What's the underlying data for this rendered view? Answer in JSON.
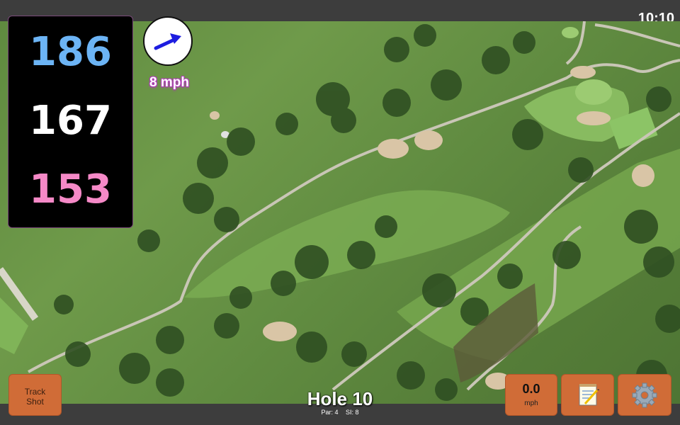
{
  "status": {
    "time": "10:10"
  },
  "distances": {
    "back": "186",
    "middle": "167",
    "front": "153"
  },
  "wind": {
    "speed_label": "8 mph",
    "icon": "wind-arrow-icon"
  },
  "hole": {
    "title": "Hole 10",
    "par_label": "Par: 4",
    "si_label": "SI: 8"
  },
  "buttons": {
    "track_shot_line1": "Track",
    "track_shot_line2": "Shot",
    "speed_value": "0.0",
    "speed_unit": "mph",
    "notes_icon": "notepad-icon",
    "settings_icon": "gear-icon"
  },
  "colors": {
    "back_distance": "#6cb4f5",
    "middle_distance": "#ffffff",
    "front_distance": "#f589c7",
    "button_accent": "#d06c37",
    "wind_arrow": "#1d1de0"
  }
}
